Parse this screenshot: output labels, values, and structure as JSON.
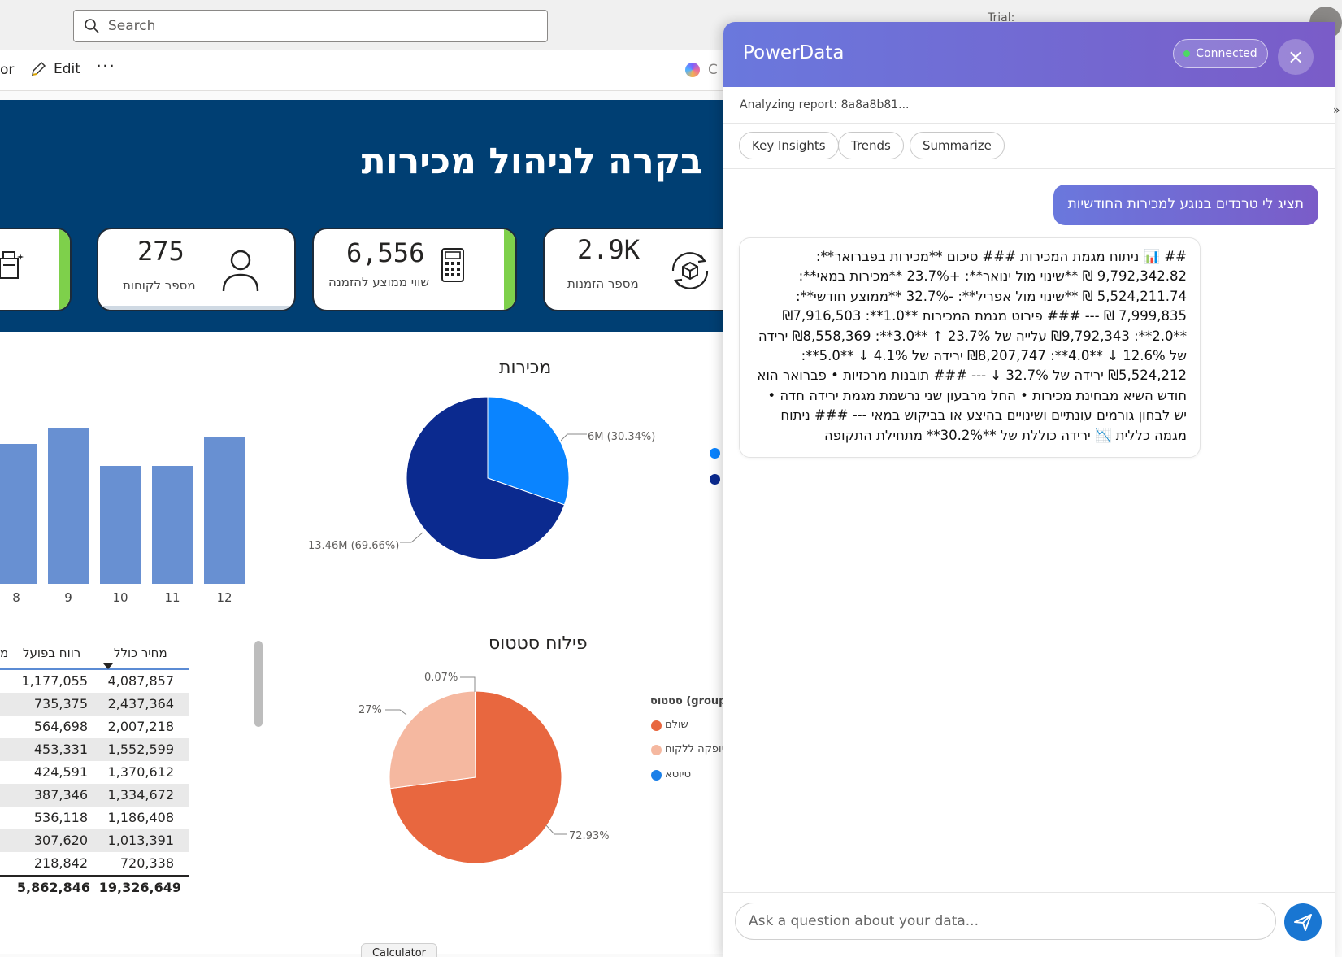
{
  "topbar": {
    "search_placeholder": "Search",
    "trial_label": "Trial:"
  },
  "toolbar": {
    "truncated_label": "or",
    "edit_label": "Edit",
    "more_label": "···",
    "copilot_label": "C"
  },
  "report": {
    "title": "בקרה לניהול מכירות",
    "kpis": [
      {
        "value": "275",
        "label": "מספר לקוחות",
        "icon": "person-icon"
      },
      {
        "value": "6,556",
        "label": "שווי ממוצע להזמנה",
        "icon": "calculator-icon"
      },
      {
        "value": "2.9K",
        "label": "מספר הזמנות",
        "icon": "box-cycle-icon"
      }
    ],
    "sales_chart": {
      "title": "מכירות"
    },
    "status_chart": {
      "title": "פילוח סטטוס",
      "legend_title": "סטטוס (group",
      "legend": [
        {
          "label": "שולם",
          "color": "#e8673f"
        },
        {
          "label": "סופקה ללקוח",
          "color": "#f5b8a0"
        },
        {
          "label": "טיוטא",
          "color": "#1a7fe8"
        }
      ]
    },
    "table": {
      "columns": [
        "מ",
        "רווח בפועל",
        "מחיר כולל"
      ],
      "rows": [
        [
          "1,177,055",
          "4,087,857"
        ],
        [
          "735,375",
          "2,437,364"
        ],
        [
          "564,698",
          "2,007,218"
        ],
        [
          "453,331",
          "1,552,599"
        ],
        [
          "424,591",
          "1,370,612"
        ],
        [
          "387,346",
          "1,334,672"
        ],
        [
          "536,118",
          "1,186,408"
        ],
        [
          "307,620",
          "1,013,391"
        ],
        [
          "218,842",
          "720,338"
        ]
      ],
      "total": [
        "5,862,846",
        "19,326,649"
      ]
    }
  },
  "chart_data": [
    {
      "type": "bar",
      "categories": [
        "8",
        "9",
        "10",
        "11",
        "12"
      ],
      "values": [
        0.82,
        0.91,
        0.69,
        0.69,
        0.86
      ],
      "ylim": [
        0,
        1
      ]
    },
    {
      "type": "pie",
      "title": "מכירות",
      "slices": [
        {
          "value": 6.0,
          "percent": 30.34,
          "label": "6M (30.34%)",
          "color": "#0a84ff"
        },
        {
          "value": 13.46,
          "percent": 69.66,
          "label": "13.46M (69.66%)",
          "color": "#0b2a8f"
        }
      ]
    },
    {
      "type": "pie",
      "title": "פילוח סטטוס",
      "slices": [
        {
          "percent": 72.93,
          "label": "72.93%",
          "color": "#e8673f"
        },
        {
          "percent": 27,
          "label": "27%",
          "color": "#f5b8a0"
        },
        {
          "percent": 0.07,
          "label": "0.07%",
          "color": "#1a7fe8"
        }
      ]
    }
  ],
  "panel": {
    "title": "PowerData",
    "status_badge": "Connected",
    "close_label": "×",
    "analyzing": "Analyzing report: 8a8a8b81...",
    "chips": [
      "Key Insights",
      "Trends",
      "Summarize"
    ],
    "user_message": "תציג לי טרנדים בנוגע למכירות החודשיות",
    "bot_message": "## 📊 ניתוח מגמת המכירות ### סיכום **מכירות בפברואר**: 9,792,342.82 ₪ **שינוי מול ינואר**: +23.7% **מכירות במאי**: 5,524,211.74 ₪ **שינוי מול אפריל**: -32.7% **ממוצע חודשי**: 7,999,835 ₪ --- ### פירוט מגמת המכירות **1.0**: ₪7,916,503 **2.0**: ₪9,792,343 עלייה של 23.7% ↑ **3.0**: ₪8,558,369 ירידה של 12.6% ↓ **4.0**: ₪8,207,747 ירידה של 4.1% ↓ **5.0**: ₪5,524,212 ירידה של 32.7% ↓ --- ### תובנות מרכזיות • פברואר הוא חודש השיא מבחינת מכירות • החל מרבעון שני נרשמת מגמת ירידה חדה • יש לבחון גורמים עונתיים ושינויים בהיצע או בביקוש במאי --- ### ניתוח מגמה כללית 📉 ירידה כוללת של **30.2%** מתחילת התקופה",
    "input_placeholder": "Ask a question about your data..."
  },
  "taskbar": {
    "tooltip": "Calculator"
  },
  "colors": {
    "header_band": "#003f73",
    "panel_gradient_start": "#6a78dd",
    "panel_gradient_end": "#7a5cc8",
    "bar": "#6890d2",
    "kpi_accent_green": "#7ed04b",
    "send_button": "#1976d2"
  }
}
